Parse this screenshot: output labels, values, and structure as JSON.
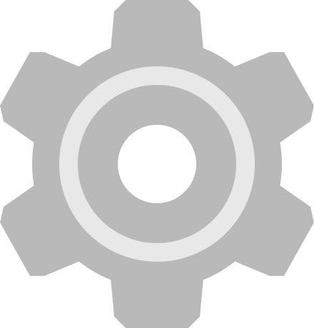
{
  "icon": {
    "name": "gear-icon",
    "colors": {
      "gear_body": "#b9b9b9",
      "ring": "#e8e8e8",
      "hole": "#ffffff",
      "background": "#ffffff"
    }
  }
}
